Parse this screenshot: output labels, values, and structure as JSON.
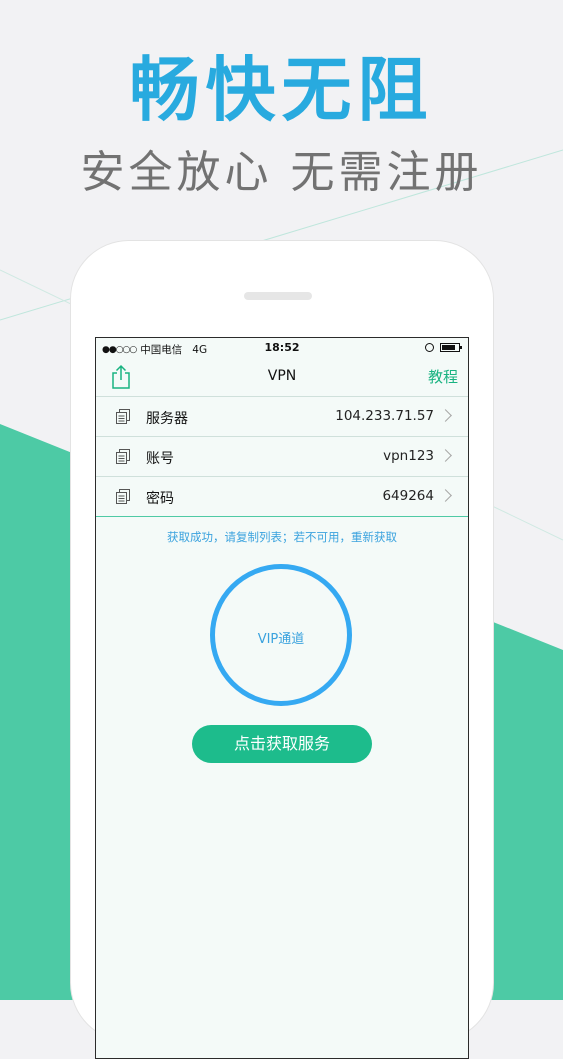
{
  "headline": "畅快无阻",
  "subline": "安全放心 无需注册",
  "colors": {
    "accent_blue": "#28aadf",
    "accent_green": "#1dbc8c",
    "bg_green": "#4dcaa5"
  },
  "status_bar": {
    "signal": "●●○○○",
    "carrier": "中国电信",
    "network": "4G",
    "time": "18:52"
  },
  "nav": {
    "title": "VPN",
    "right_label": "教程",
    "left_icon": "share-icon"
  },
  "rows": [
    {
      "label": "服务器",
      "value": "104.233.71.57"
    },
    {
      "label": "账号",
      "value": "vpn123"
    },
    {
      "label": "密码",
      "value": "649264"
    }
  ],
  "hint": "获取成功，请复制列表；若不可用，重新获取",
  "circle_label": "VIP通道",
  "action_button": "点击获取服务"
}
